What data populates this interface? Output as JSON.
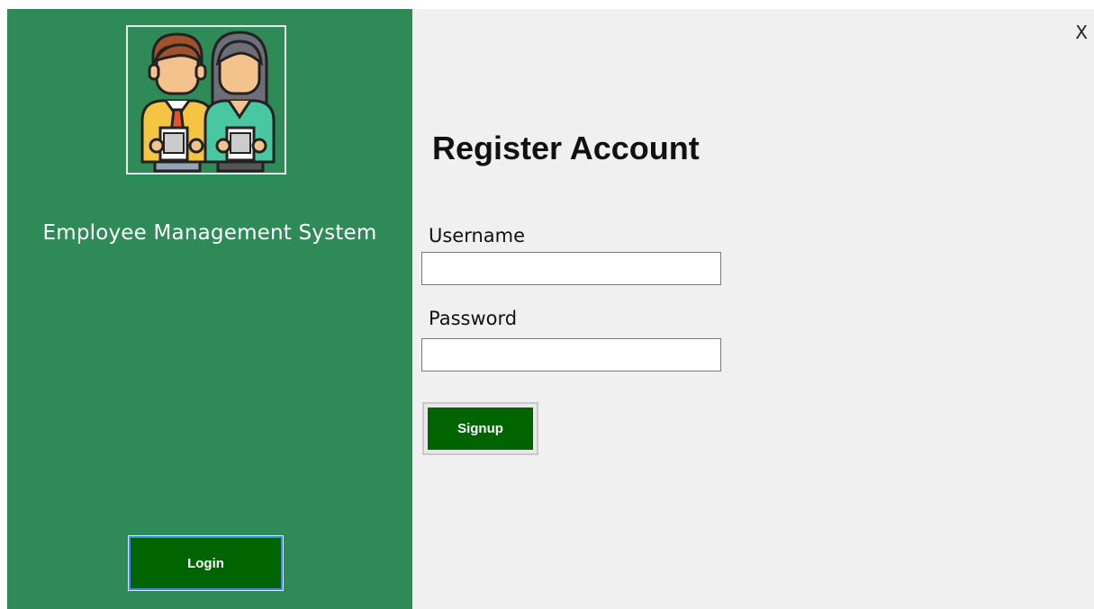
{
  "window": {
    "close_label": "X"
  },
  "sidebar": {
    "logo_icon": "employees-icon",
    "app_title": "Employee Management System",
    "login_label": "Login",
    "background_color": "#2e8b57"
  },
  "form": {
    "title": "Register Account",
    "username_label": "Username",
    "username_value": "",
    "password_label": "Password",
    "password_value": "",
    "signup_label": "Signup",
    "button_color": "#006400"
  }
}
